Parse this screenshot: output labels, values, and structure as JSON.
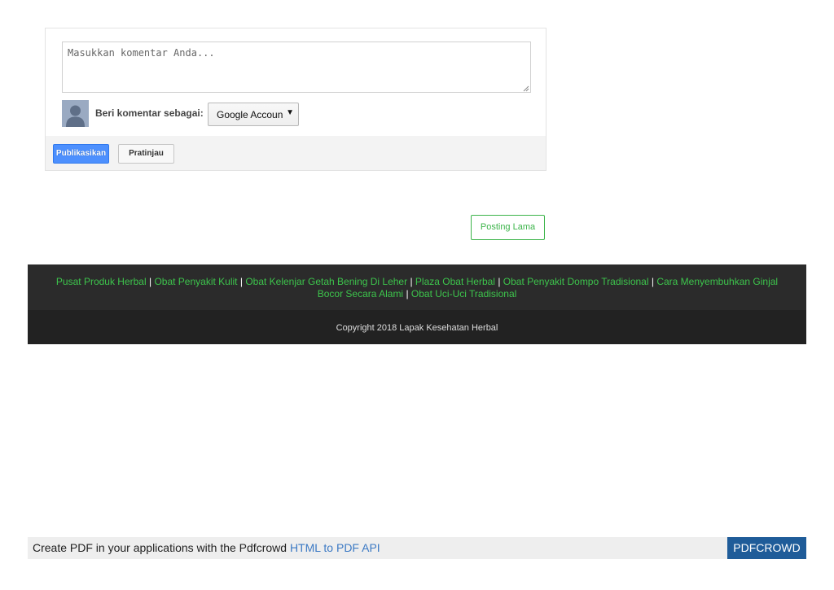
{
  "comment_form": {
    "placeholder": "Masukkan komentar Anda...",
    "comment_as_label": "Beri komentar sebagai:",
    "account_selected": "Google Accoun",
    "dropdown_arrow": "▼",
    "publish_label": "Publikasikan",
    "preview_label": "Pratinjau"
  },
  "pager": {
    "older_posts_label": "Posting Lama"
  },
  "footer": {
    "links": [
      {
        "label": "Pusat Produk Herbal"
      },
      {
        "label": "Obat Penyakit Kulit"
      },
      {
        "label": "Obat Kelenjar Getah Bening Di Leher"
      },
      {
        "label": "Plaza Obat Herbal"
      },
      {
        "label": "Obat Penyakit Dompo Tradisional"
      },
      {
        "label": "Cara Menyembuhkan Ginjal Bocor Secara Alami"
      },
      {
        "label": "Obat Uci-Uci Tradisional"
      }
    ],
    "separator": "|",
    "copyright": "Copyright 2018 Lapak Kesehatan Herbal",
    "link_color": "#3dc44c"
  },
  "pdf_banner": {
    "text": "Create PDF in your applications with the Pdfcrowd ",
    "link_label": "HTML to PDF API",
    "badge_label": "PDFCROWD",
    "badge_color": "#1f5c99"
  },
  "colors": {
    "accent_green": "#3cb44a",
    "publish_blue": "#4d90fe"
  }
}
